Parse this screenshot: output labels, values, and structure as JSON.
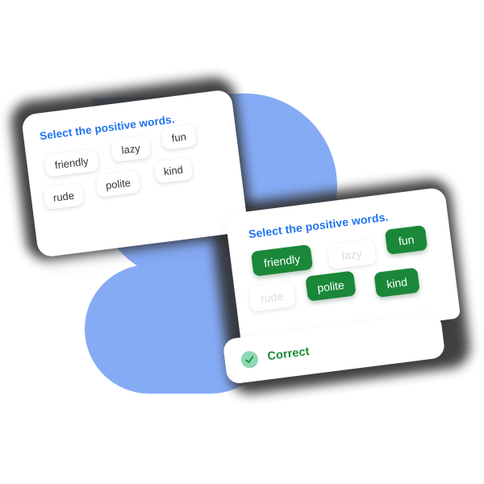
{
  "theme": {
    "background": "#ffffff",
    "blob_blue": "#85abf5",
    "prompt_blue": "#1f73f1",
    "selected_green": "#1a8838",
    "correct_green": "#1a8a38",
    "check_circle_mint": "#8ed7b2",
    "chip_text": "#343434",
    "chip_text_faded": "#dcdcdc",
    "card_white": "#ffffff",
    "shadow_dark": "#333333"
  },
  "cards": [
    {
      "id": "card-unanswered",
      "prompt": "Select the positive words.",
      "chips": [
        {
          "label": "friendly",
          "state": "default"
        },
        {
          "label": "lazy",
          "state": "default"
        },
        {
          "label": "fun",
          "state": "default"
        },
        {
          "label": "rude",
          "state": "default"
        },
        {
          "label": "polite",
          "state": "default"
        },
        {
          "label": "kind",
          "state": "default"
        }
      ]
    },
    {
      "id": "card-answered",
      "prompt": "Select the positive words.",
      "chips": [
        {
          "label": "friendly",
          "state": "selected"
        },
        {
          "label": "lazy",
          "state": "faded"
        },
        {
          "label": "fun",
          "state": "selected"
        },
        {
          "label": "rude",
          "state": "faded"
        },
        {
          "label": "polite",
          "state": "selected"
        },
        {
          "label": "kind",
          "state": "selected"
        }
      ],
      "feedback": {
        "icon": "check-circle-icon",
        "label": "Correct"
      }
    }
  ]
}
